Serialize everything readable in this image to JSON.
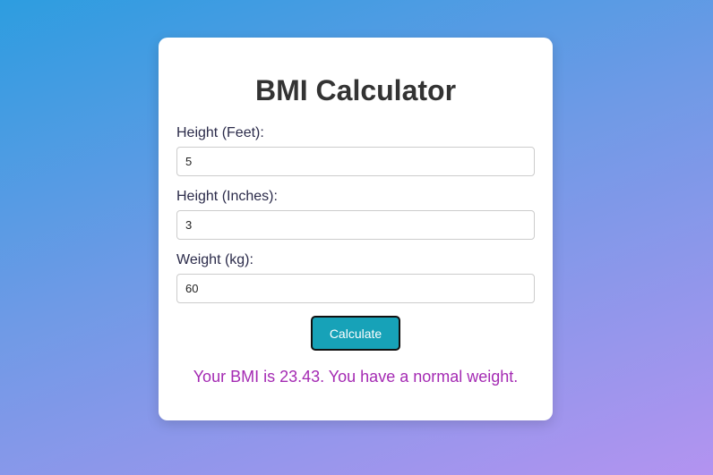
{
  "title": "BMI Calculator",
  "fields": {
    "height_feet": {
      "label": "Height (Feet):",
      "value": "5"
    },
    "height_inches": {
      "label": "Height (Inches):",
      "value": "3"
    },
    "weight_kg": {
      "label": "Weight (kg):",
      "value": "60"
    }
  },
  "button": {
    "label": "Calculate"
  },
  "result": "Your BMI is 23.43. You have a normal weight.",
  "colors": {
    "button_bg": "#17a2b8",
    "result_text": "#a42ab3",
    "title_text": "#333333"
  }
}
